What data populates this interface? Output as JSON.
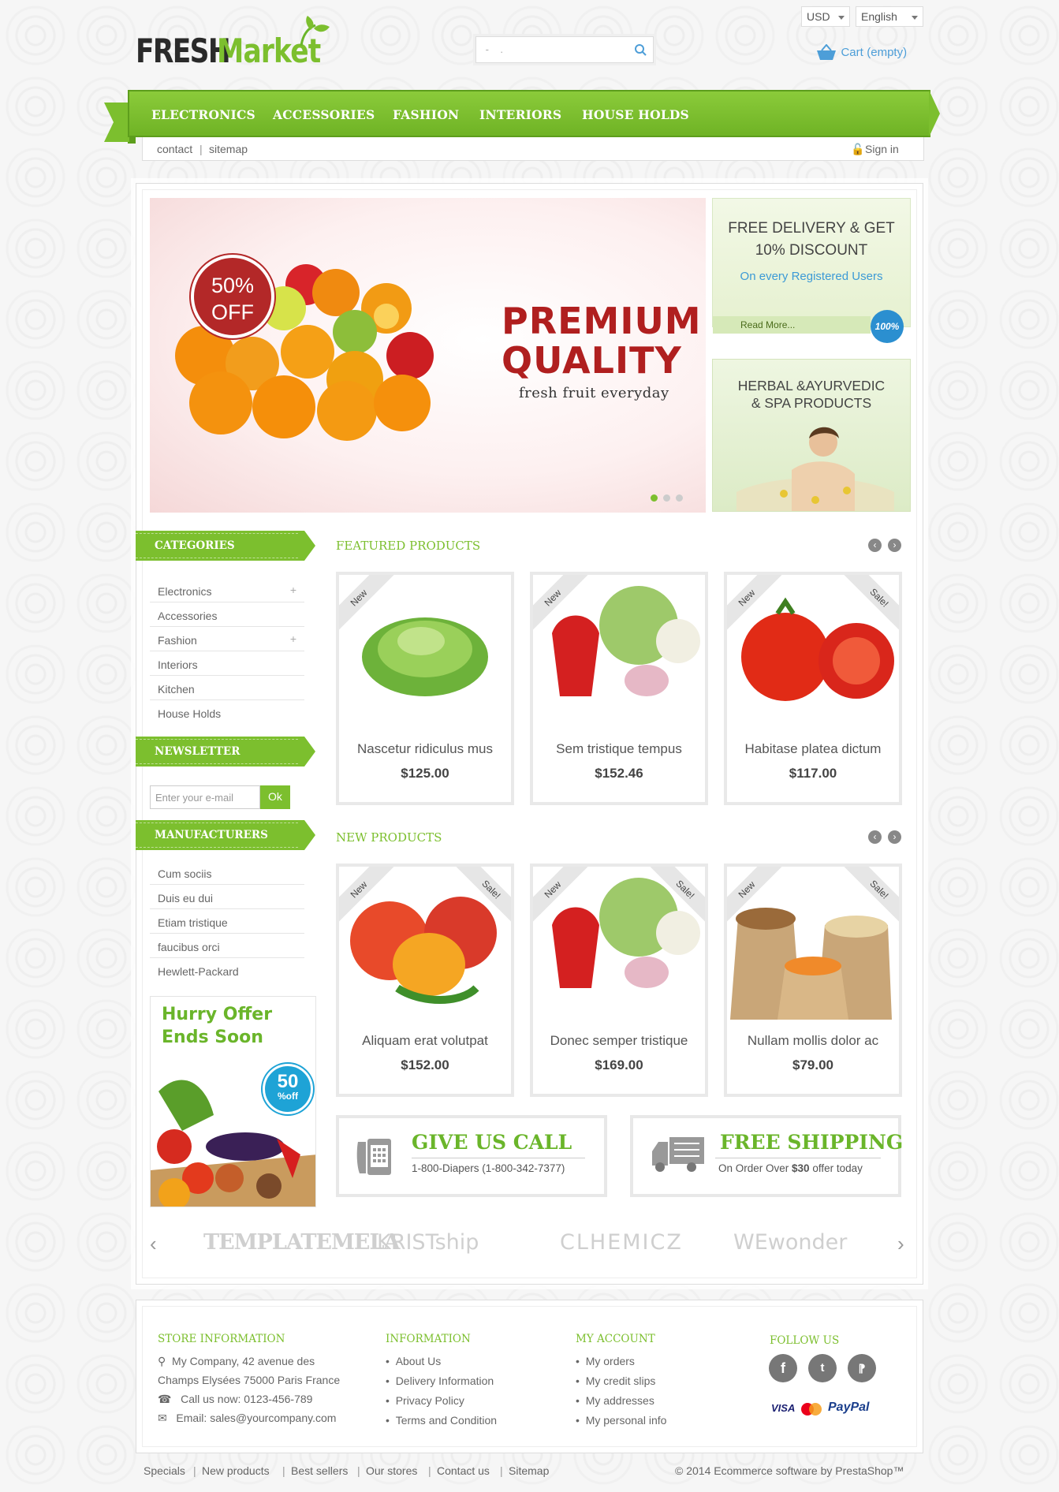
{
  "header": {
    "logo_part1": "FRESH",
    "logo_part2": "Market",
    "currency": "USD",
    "language": "English",
    "search_placeholder": "",
    "cart_label": "Cart",
    "cart_status": "(empty)"
  },
  "nav": {
    "items": [
      "ELECTRONICS",
      "ACCESSORIES",
      "FASHION",
      "INTERIORS",
      "HOUSE HOLDS"
    ],
    "contact": "contact",
    "sitemap": "sitemap",
    "sign_in": "Sign in"
  },
  "slider": {
    "discount_top": "50%",
    "discount_bottom": "OFF",
    "headline_1": "PREMIUM",
    "headline_2": "QUALITY",
    "subline": "fresh fruit everyday",
    "active_dot": 0
  },
  "promo1": {
    "title_1": "FREE DELIVERY & GET",
    "title_2": "10% DISCOUNT",
    "subtitle": "On every Registered Users",
    "read_more": "Read More...",
    "badge": "100%"
  },
  "promo2": {
    "title_1": "HERBAL &AYURVEDIC",
    "title_2": "& SPA PRODUCTS"
  },
  "sidebar": {
    "categories_title": "CATEGORIES",
    "categories": [
      {
        "label": "Electronics",
        "expandable": true
      },
      {
        "label": "Accessories",
        "expandable": false
      },
      {
        "label": "Fashion",
        "expandable": true
      },
      {
        "label": "Interiors",
        "expandable": false
      },
      {
        "label": "Kitchen",
        "expandable": false
      },
      {
        "label": "House Holds",
        "expandable": false
      }
    ],
    "newsletter_title": "NEWSLETTER",
    "newsletter_placeholder": "Enter your e-mail",
    "newsletter_button": "Ok",
    "manufacturers_title": "MANUFACTURERS",
    "manufacturers": [
      "Cum sociis",
      "Duis eu dui",
      "Etiam tristique",
      "faucibus orci",
      "Hewlett-Packard"
    ],
    "hurry_1": "Hurry Offer",
    "hurry_2": "Ends Soon",
    "hurry_badge_1": "50",
    "hurry_badge_2": "%off"
  },
  "featured": {
    "title": "FEATURED PRODUCTS",
    "products": [
      {
        "name": "Nascetur ridiculus mus",
        "price": "$125.00",
        "new": "New",
        "sale": ""
      },
      {
        "name": "Sem tristique tempus",
        "price": "$152.46",
        "new": "New",
        "sale": ""
      },
      {
        "name": "Habitase platea dictum",
        "price": "$117.00",
        "new": "New",
        "sale": "Sale!"
      }
    ]
  },
  "new_products": {
    "title": "NEW PRODUCTS",
    "products": [
      {
        "name": "Aliquam erat volutpat",
        "price": "$152.00",
        "new": "New",
        "sale": "Sale!"
      },
      {
        "name": "Donec semper tristique",
        "price": "$169.00",
        "new": "New",
        "sale": "Sale!"
      },
      {
        "name": "Nullam mollis dolor ac",
        "price": "$79.00",
        "new": "New",
        "sale": "Sale!"
      }
    ]
  },
  "call": {
    "title": "GIVE US CALL",
    "text": "1-800-Diapers (1-800-342-7377)"
  },
  "shipping": {
    "title": "FREE SHIPPING",
    "text_prefix": "On Order Over ",
    "amount": "$30",
    "text_suffix": " offer today"
  },
  "brands": [
    "TEMPLATEMELA",
    "KRISTship",
    "CLHEMICZ",
    "WEwonder"
  ],
  "footer": {
    "store_title": "STORE INFORMATION",
    "address_1": "My Company, 42 avenue des",
    "address_2": "Champs Elysées 75000 Paris France",
    "call": "Call us now: 0123-456-789",
    "email": "Email: sales@yourcompany.com",
    "info_title": "INFORMATION",
    "info_links": [
      "About Us",
      "Delivery Information",
      "Privacy Policy",
      "Terms and Condition"
    ],
    "account_title": "MY ACCOUNT",
    "account_links": [
      "My orders",
      "My credit slips",
      "My addresses",
      "My personal info"
    ],
    "follow_title": "FOLLOW US",
    "payments": [
      "VISA",
      "PayPal"
    ],
    "bottom_links": [
      "Specials",
      "New products",
      "Best sellers",
      "Our stores",
      "Contact us",
      "Sitemap"
    ],
    "copyright": "© 2014 Ecommerce software by PrestaShop™"
  },
  "colors": {
    "brand_green": "#7cbf2e",
    "price_red": "#b01f1f",
    "link_blue": "#4d9ed8"
  }
}
